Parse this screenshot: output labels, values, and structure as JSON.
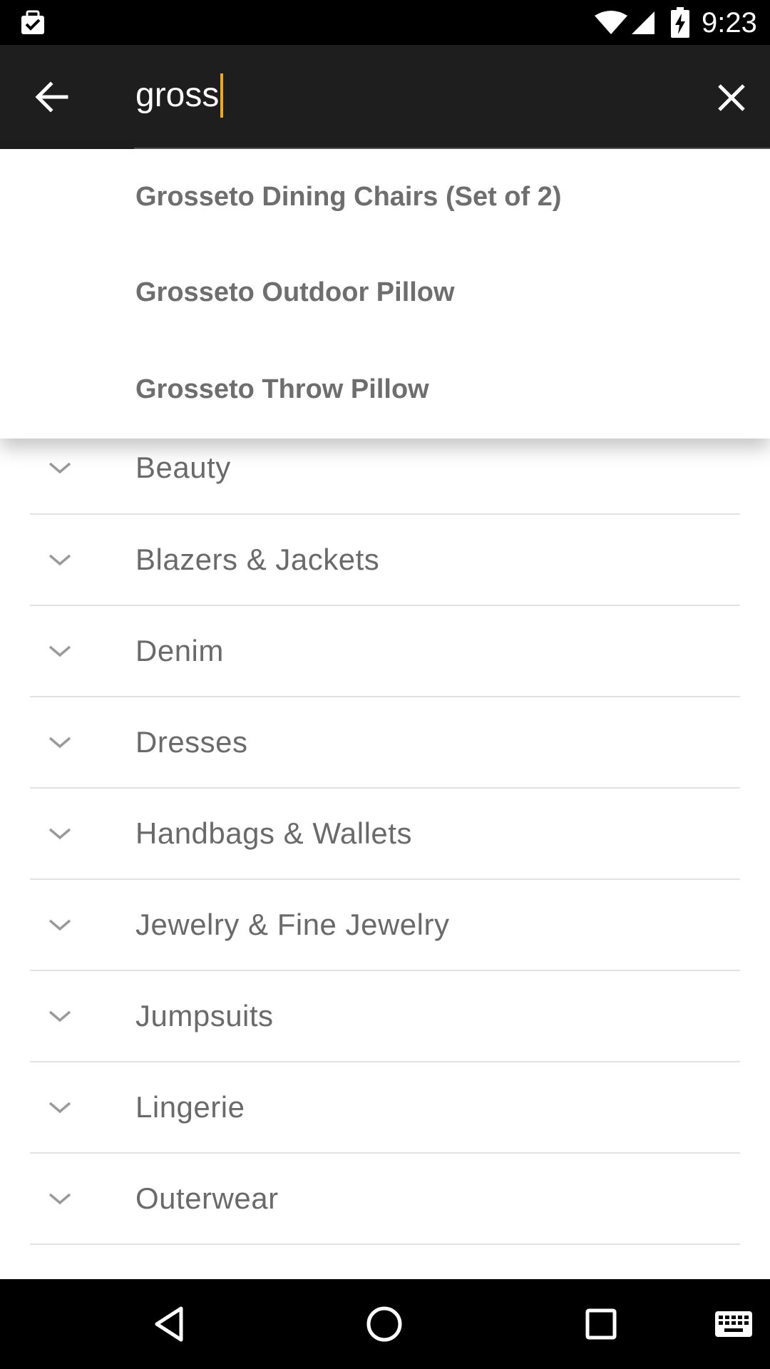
{
  "status_bar": {
    "time": "9:23",
    "icons": [
      "notification-icon",
      "wifi-icon",
      "signal-icon",
      "battery-charging-icon"
    ]
  },
  "search": {
    "query": "gross",
    "back_icon": "arrow-back-icon",
    "clear_icon": "close-icon",
    "caret_color": "#f0a818"
  },
  "suggestions": [
    {
      "label": "Grosseto Dining Chairs (Set of 2)"
    },
    {
      "label": "Grosseto Outdoor Pillow"
    },
    {
      "label": "Grosseto Throw Pillow"
    }
  ],
  "categories": [
    {
      "label": "Beauty"
    },
    {
      "label": "Blazers & Jackets"
    },
    {
      "label": "Denim"
    },
    {
      "label": "Dresses"
    },
    {
      "label": "Handbags & Wallets"
    },
    {
      "label": "Jewelry & Fine Jewelry"
    },
    {
      "label": "Jumpsuits"
    },
    {
      "label": "Lingerie"
    },
    {
      "label": "Outerwear"
    }
  ],
  "nav_bar": {
    "icons": [
      "back-triangle-icon",
      "home-circle-icon",
      "recents-square-icon",
      "keyboard-icon"
    ]
  }
}
